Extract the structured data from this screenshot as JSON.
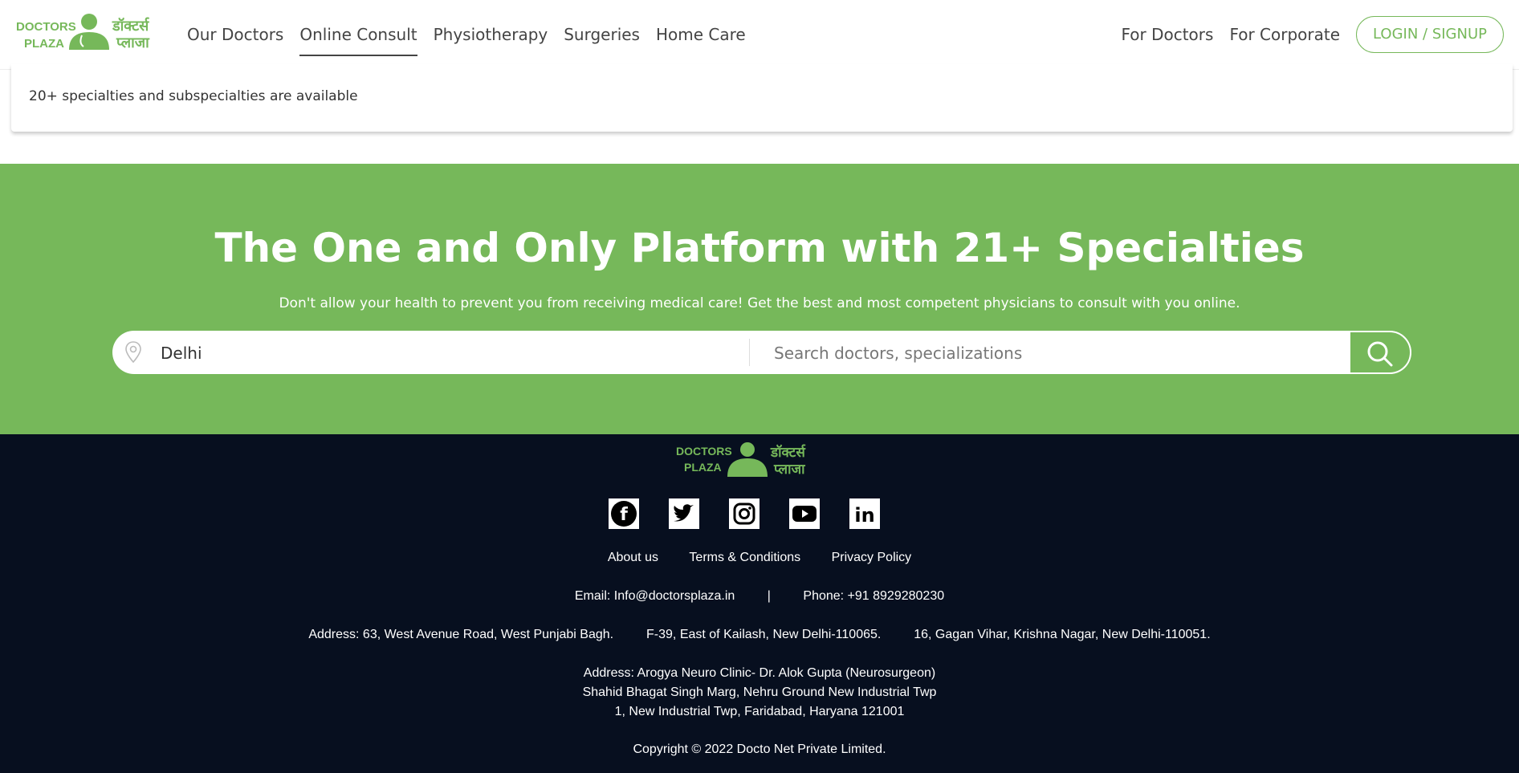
{
  "brand": {
    "name_en_line1": "DOCTORS",
    "name_en_line2": "PLAZA",
    "name_hi_line1": "डॉक्टर्स",
    "name_hi_line2": "प्लाजा",
    "color": "#76b85a"
  },
  "nav": {
    "items": [
      {
        "label": "Our Doctors"
      },
      {
        "label": "Online Consult",
        "active": true
      },
      {
        "label": "Physiotherapy"
      },
      {
        "label": "Surgeries"
      },
      {
        "label": "Home Care"
      }
    ],
    "right": [
      {
        "label": "For Doctors"
      },
      {
        "label": "For Corporate"
      }
    ],
    "login_label": "LOGIN / SIGNUP"
  },
  "info": {
    "text": "20+ specialties and subspecialties are available"
  },
  "hero": {
    "title": "The One and Only Platform with 21+ Specialties",
    "subtitle": "Don't allow your health to prevent you from receiving medical care! Get the best and most competent physicians to consult with you online.",
    "location_value": "Delhi",
    "search_placeholder": "Search doctors, specializations",
    "bg_color": "#76b85a"
  },
  "footer": {
    "social": [
      "facebook-icon",
      "twitter-icon",
      "instagram-icon",
      "youtube-icon",
      "linkedin-icon"
    ],
    "links": [
      "About us",
      "Terms & Conditions",
      "Privacy Policy"
    ],
    "email": "Email: Info@doctorsplaza.in",
    "separator": "|",
    "phone": "Phone: +91 8929280230",
    "address1": "Address: 63, West Avenue Road, West Punjabi Bagh.",
    "address2": "F-39, East of Kailash, New Delhi-110065.",
    "address3": "16, Gagan Vihar, Krishna Nagar, New Delhi-110051.",
    "clinic_line1": "Address: Arogya Neuro Clinic- Dr. Alok Gupta (Neurosurgeon)",
    "clinic_line2": "Shahid Bhagat Singh Marg, Nehru Ground New Industrial Twp",
    "clinic_line3": "1, New Industrial Twp, Faridabad, Haryana 121001",
    "copyright": "Copyright © 2022 Docto Net Private Limited.",
    "bg_color": "#070f1f"
  }
}
